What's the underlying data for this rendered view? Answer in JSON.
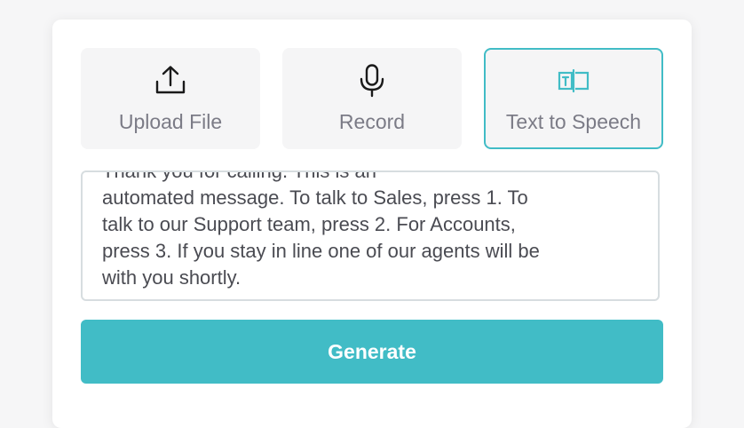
{
  "tabs": [
    {
      "label": "Upload File",
      "icon": "upload-icon"
    },
    {
      "label": "Record",
      "icon": "microphone-icon"
    },
    {
      "label": "Text to Speech",
      "icon": "text-to-speech-icon",
      "selected": true
    }
  ],
  "textarea": {
    "value": "Thank you for calling. This is an\nautomated message. To talk to Sales, press 1. To\ntalk to our Support team, press 2. For Accounts,\npress 3. If you stay in line one of our agents will be\nwith you shortly."
  },
  "generate_label": "Generate",
  "colors": {
    "accent": "#41bcc6",
    "tab_bg": "#f5f5f6",
    "label": "#7b7b86",
    "text": "#4a4b52"
  }
}
